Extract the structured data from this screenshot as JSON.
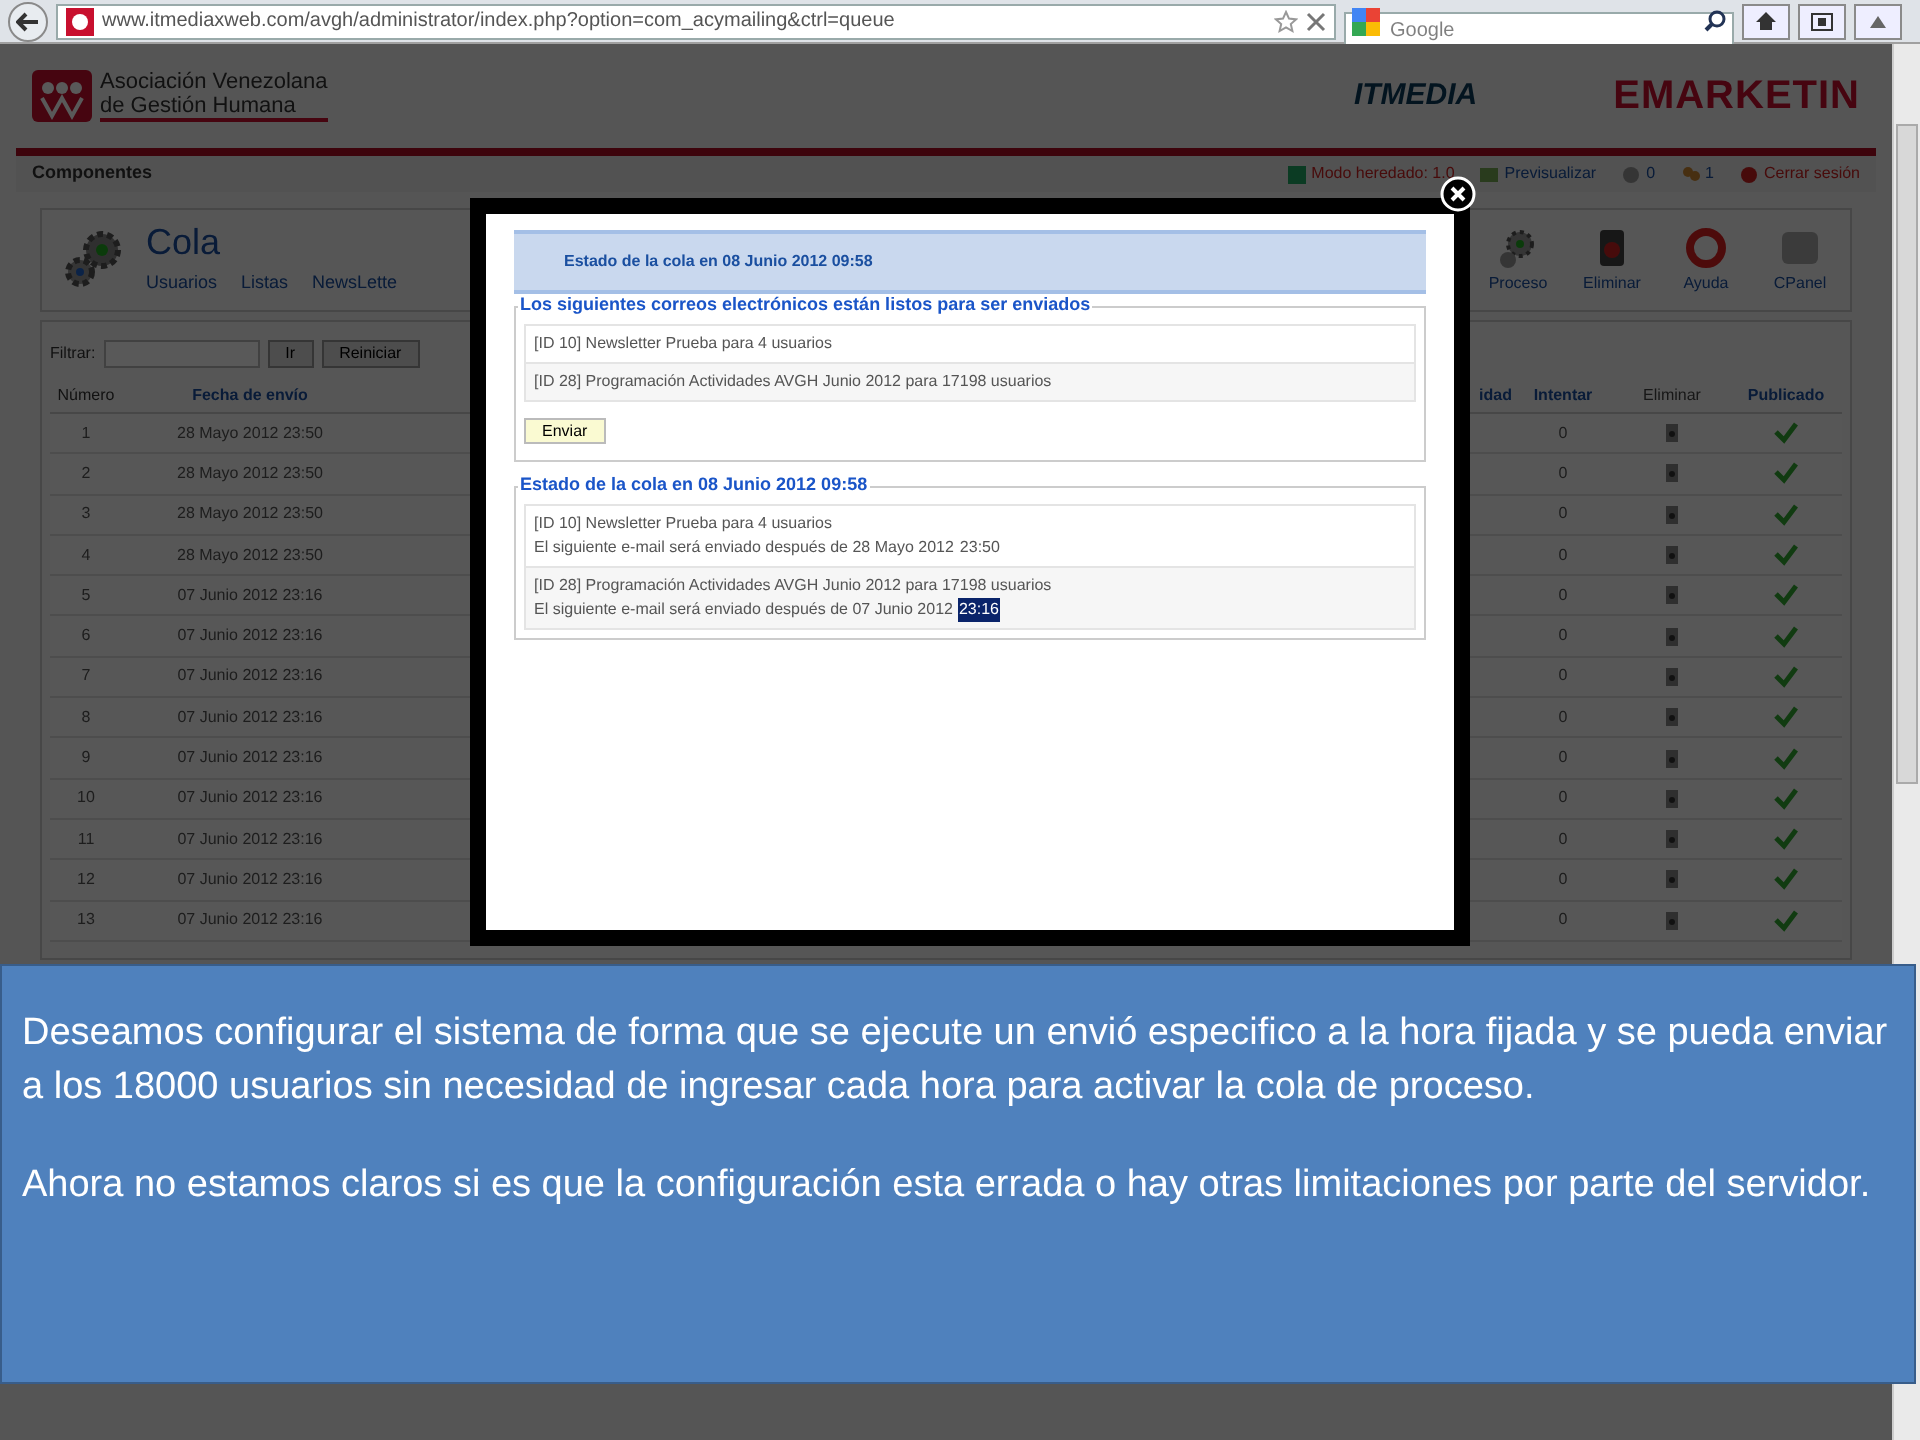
{
  "browser": {
    "url": "www.itmediaxweb.com/avgh/administrator/index.php?option=com_acymailing&ctrl=queue",
    "search_placeholder": "Google"
  },
  "header": {
    "org_name": [
      "Asociación Venezolana",
      "de Gestión Humana"
    ],
    "brand": "ITMEDIA",
    "product": "EMARKETIN"
  },
  "topbar": {
    "title": "Componentes",
    "links": [
      {
        "kind": "mode",
        "label": "Modo heredado: 1.0"
      },
      {
        "kind": "preview",
        "label": "Previsualizar"
      },
      {
        "kind": "visitors",
        "label": "0"
      },
      {
        "kind": "users",
        "label": "1"
      },
      {
        "kind": "logout",
        "label": "Cerrar sesión"
      }
    ]
  },
  "toolbar": {
    "title": "Cola",
    "menus": [
      "Usuarios",
      "Listas",
      "NewsLette"
    ],
    "actions": [
      {
        "kind": "process",
        "label": "Proceso"
      },
      {
        "kind": "delete",
        "label": "Eliminar"
      },
      {
        "kind": "help",
        "label": "Ayuda"
      },
      {
        "kind": "cpanel",
        "label": "CPanel"
      }
    ]
  },
  "filter": {
    "label": "Filtrar:",
    "buttons": [
      "Ir",
      "Reiniciar"
    ]
  },
  "table": {
    "columns": [
      "Número",
      "Fecha de envío",
      "idad",
      "Intentar",
      "Eliminar",
      "Publicado"
    ],
    "rows": [
      {
        "number": "1",
        "date": "28 Mayo 2012 23:50",
        "tries": "0",
        "published": true
      },
      {
        "number": "2",
        "date": "28 Mayo 2012 23:50",
        "tries": "0",
        "published": true
      },
      {
        "number": "3",
        "date": "28 Mayo 2012 23:50",
        "tries": "0",
        "published": true
      },
      {
        "number": "4",
        "date": "28 Mayo 2012 23:50",
        "tries": "0",
        "published": true
      },
      {
        "number": "5",
        "date": "07 Junio 2012 23:16",
        "tries": "0",
        "published": true
      },
      {
        "number": "6",
        "date": "07 Junio 2012 23:16",
        "tries": "0",
        "published": true
      },
      {
        "number": "7",
        "date": "07 Junio 2012 23:16",
        "tries": "0",
        "published": true
      },
      {
        "number": "8",
        "date": "07 Junio 2012 23:16",
        "tries": "0",
        "published": true
      },
      {
        "number": "9",
        "date": "07 Junio 2012 23:16",
        "tries": "0",
        "published": true
      },
      {
        "number": "10",
        "date": "07 Junio 2012 23:16",
        "tries": "0",
        "published": true
      },
      {
        "number": "11",
        "date": "07 Junio 2012 23:16",
        "tries": "0",
        "published": true
      },
      {
        "number": "12",
        "date": "07 Junio 2012 23:16",
        "tries": "0",
        "published": true
      },
      {
        "number": "13",
        "date": "07 Junio 2012 23:16",
        "tries": "0",
        "published": true
      }
    ]
  },
  "modal": {
    "header": "Estado de la cola en 08 Junio 2012 09:58",
    "ready": {
      "legend": "Los siguientes correos electrónicos están listos para ser enviados",
      "items": [
        "[ID 10] Newsletter Prueba para 4 usuarios",
        "[ID 28] Programación Actividades AVGH Junio 2012 para 17198 usuarios"
      ],
      "button": "Enviar"
    },
    "status": {
      "legend": "Estado de la cola en 08 Junio 2012 09:58",
      "items": [
        {
          "title": "[ID 10] Newsletter Prueba para 4 usuarios",
          "next_send": "El siguiente e-mail será enviado después de 28 Mayo 2012",
          "time": "23:50",
          "selected": false
        },
        {
          "title": "[ID 28] Programación Actividades AVGH Junio 2012 para 17198 usuarios",
          "next_send": "El siguiente e-mail será enviado después de 07 Junio 2012",
          "time": "23:16",
          "selected": true
        }
      ]
    }
  },
  "callout": {
    "paragraphs": [
      "Deseamos configurar el sistema de forma que se ejecute un envió especifico a la hora fijada y se pueda enviar a los 18000 usuarios sin necesidad de ingresar cada hora para activar la cola de proceso.",
      "Ahora no estamos claros si es que la configuración esta errada o hay otras limitaciones por parte del servidor."
    ]
  }
}
